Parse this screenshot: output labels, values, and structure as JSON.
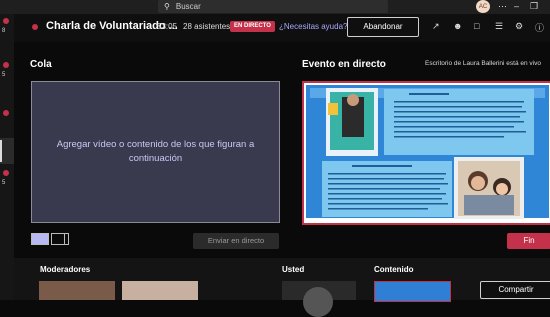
{
  "search": {
    "placeholder": "Buscar",
    "icon": "search-icon"
  },
  "top": {
    "avatar_initials": "AC"
  },
  "rail": {
    "badges": [
      "8",
      "5",
      "5"
    ]
  },
  "meeting": {
    "title": "Charla de Voluntariado ...",
    "timer": "53:05",
    "attendees": "28 asistentes",
    "live_badge": "EN DIRECTO",
    "help": "¿Necesitas ayuda?",
    "leave": "Abandonar"
  },
  "queue": {
    "label": "Cola",
    "empty_text": "Agregar vídeo o contenido de los que figuran a continuación",
    "send_live": "Enviar en directo"
  },
  "live_event": {
    "label": "Evento en directo",
    "screen_note": "Escritorio de Laura Ballerini está en vivo",
    "end": "Fin"
  },
  "bottom": {
    "moderators": "Moderadores",
    "you": "Usted",
    "content": "Contenido",
    "share": "Compartir"
  },
  "colors": {
    "accent_red": "#c4314b",
    "link": "#a8a8ff",
    "queue_bg": "#3a3a4e",
    "slide_blue": "#2f7fd4"
  }
}
